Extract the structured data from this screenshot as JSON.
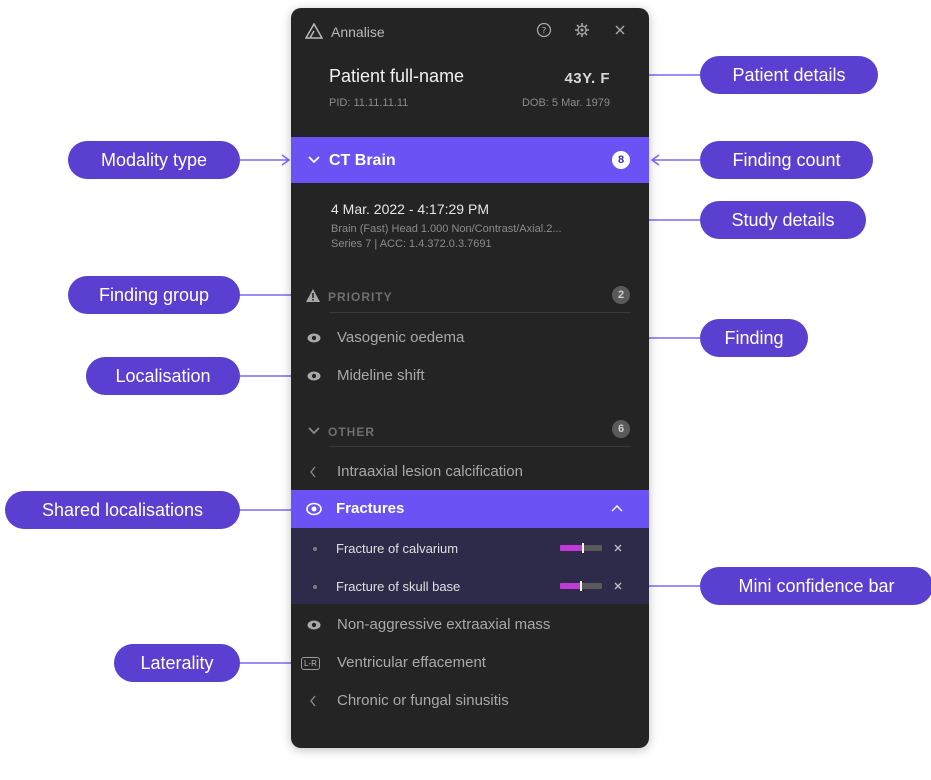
{
  "app": {
    "name": "Annalise"
  },
  "patient": {
    "name": "Patient full-name",
    "age_sex": "43Y. F",
    "pid": "PID: 11.11.11.11",
    "dob": "DOB: 5 Mar. 1979"
  },
  "modality": {
    "label": "CT Brain",
    "count": "8"
  },
  "study": {
    "datetime": "4 Mar. 2022 - 4:17:29 PM",
    "description": "Brain (Fast) Head 1.000 Non/Contrast/Axial.2...",
    "series": "Series 7  |  ACC: 1.4.372.0.3.7691"
  },
  "groups": {
    "priority": {
      "label": "PRIORITY",
      "count": "2"
    },
    "other": {
      "label": "OTHER",
      "count": "6"
    }
  },
  "findings": {
    "vasogenic": "Vasogenic oedema",
    "midline": "Mideline shift",
    "intraaxial": "Intraaxial lesion calcification",
    "fractures": "Fractures",
    "calvarium": "Fracture of calvarium",
    "skull_base": "Fracture of skull base",
    "nonaggressive": "Non-aggressive extraaxial mass",
    "ventricular": "Ventricular effacement",
    "sinusitis": "Chronic or fungal sinusitis",
    "laterality_badge": "L-R"
  },
  "confidence": {
    "calvarium": 0.55,
    "skull_base": 0.5
  },
  "callouts": {
    "patient_details": "Patient details",
    "modality_type": "Modality type",
    "finding_count": "Finding count",
    "study_details": "Study details",
    "finding_group": "Finding group",
    "finding": "Finding",
    "localisation": "Localisation",
    "shared_localisations": "Shared localisations",
    "mini_confidence_bar": "Mini confidence bar",
    "laterality": "Laterality"
  },
  "colors": {
    "accent": "#6a52f4",
    "callout": "#5a3fd0",
    "panel": "#242424",
    "confidence": "#c23ad6"
  }
}
